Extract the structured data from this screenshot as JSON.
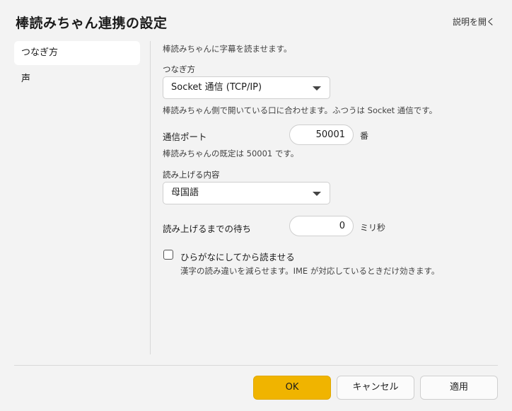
{
  "window": {
    "title": "棒読みちゃん連携の設定",
    "help_link": "説明を開く"
  },
  "sidebar": {
    "items": [
      {
        "label": "つなぎ方",
        "active": true
      },
      {
        "label": "声",
        "active": false
      }
    ]
  },
  "content": {
    "intro": "棒読みちゃんに字幕を読ませます。",
    "connection": {
      "label": "つなぎ方",
      "selected": "Socket 通信 (TCP/IP)",
      "help": "棒読みちゃん側で開いている口に合わせます。ふつうは Socket 通信です。"
    },
    "port": {
      "label": "通信ポート",
      "value": "50001",
      "unit": "番",
      "help": "棒読みちゃんの既定は 50001 です。"
    },
    "read_content": {
      "label": "読み上げる内容",
      "selected": "母国語"
    },
    "wait": {
      "label": "読み上げるまでの待ち",
      "value": "0",
      "unit": "ミリ秒"
    },
    "hiragana": {
      "label": "ひらがなにしてから読ませる",
      "checked": false,
      "help": "漢字の読み違いを減らせます。IME が対応しているときだけ効きます。"
    }
  },
  "footer": {
    "ok": "OK",
    "cancel": "キャンセル",
    "apply": "適用"
  },
  "colors": {
    "accent": "#f0b400",
    "background": "#f3f3f3"
  }
}
